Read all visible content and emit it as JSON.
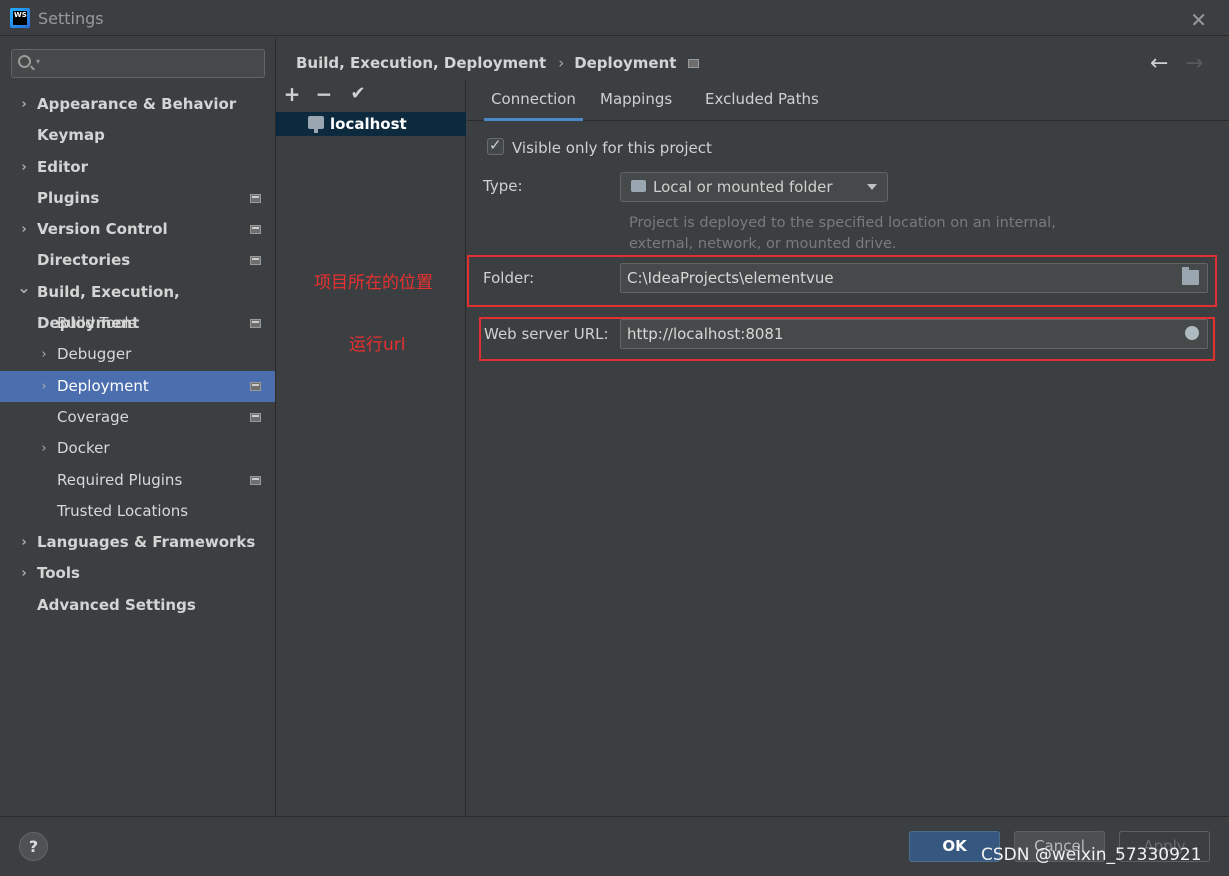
{
  "window": {
    "title": "Settings",
    "logo_text": "WS"
  },
  "sidebar": {
    "search_placeholder": "",
    "items": [
      {
        "label": "Appearance & Behavior",
        "bold": true,
        "chevron": true,
        "indent": 0,
        "project": false
      },
      {
        "label": "Keymap",
        "bold": true,
        "chevron": false,
        "indent": 0,
        "project": false
      },
      {
        "label": "Editor",
        "bold": true,
        "chevron": true,
        "indent": 0,
        "project": false
      },
      {
        "label": "Plugins",
        "bold": true,
        "chevron": false,
        "indent": 0,
        "project": true
      },
      {
        "label": "Version Control",
        "bold": true,
        "chevron": true,
        "indent": 0,
        "project": true
      },
      {
        "label": "Directories",
        "bold": true,
        "chevron": false,
        "indent": 0,
        "project": true
      },
      {
        "label": "Build, Execution, Deployment",
        "bold": true,
        "chevron": "down",
        "indent": 0,
        "project": false
      },
      {
        "label": "Build Tools",
        "bold": false,
        "chevron": false,
        "indent": 1,
        "project": true
      },
      {
        "label": "Debugger",
        "bold": false,
        "chevron": true,
        "indent": 1,
        "project": false
      },
      {
        "label": "Deployment",
        "bold": false,
        "chevron": true,
        "indent": 1,
        "project": true,
        "selected": true
      },
      {
        "label": "Coverage",
        "bold": false,
        "chevron": false,
        "indent": 1,
        "project": true
      },
      {
        "label": "Docker",
        "bold": false,
        "chevron": true,
        "indent": 1,
        "project": false
      },
      {
        "label": "Required Plugins",
        "bold": false,
        "chevron": false,
        "indent": 1,
        "project": true
      },
      {
        "label": "Trusted Locations",
        "bold": false,
        "chevron": false,
        "indent": 1,
        "project": false
      },
      {
        "label": "Languages & Frameworks",
        "bold": true,
        "chevron": true,
        "indent": 0,
        "project": false
      },
      {
        "label": "Tools",
        "bold": true,
        "chevron": true,
        "indent": 0,
        "project": false
      },
      {
        "label": "Advanced Settings",
        "bold": true,
        "chevron": false,
        "indent": 0,
        "project": false
      }
    ]
  },
  "breadcrumb": {
    "parent": "Build, Execution, Deployment",
    "separator": "›",
    "current": "Deployment"
  },
  "servers": {
    "toolbar": {
      "add": "+",
      "remove": "−",
      "default": "✔"
    },
    "items": [
      {
        "label": "localhost"
      }
    ]
  },
  "tabs": [
    {
      "label": "Connection",
      "active": true
    },
    {
      "label": "Mappings"
    },
    {
      "label": "Excluded Paths"
    }
  ],
  "connection": {
    "visible_only_label": "Visible only for this project",
    "visible_only_checked": true,
    "type_label": "Type:",
    "type_value": "Local or mounted folder",
    "type_description": "Project is deployed to the specified location on an internal, external, network, or mounted drive.",
    "folder_label": "Folder:",
    "folder_value": "C:\\IdeaProjects\\elementvue",
    "url_label": "Web server URL:",
    "url_value": "http://localhost:8081"
  },
  "annotations": {
    "folder_note": "项目所在的位置",
    "url_note": "运行url"
  },
  "buttons": {
    "help": "?",
    "ok": "OK",
    "cancel": "Cancel",
    "apply": "Apply"
  },
  "watermark": "CSDN @weixin_57330921",
  "colors": {
    "selection": "#4b6eaf",
    "accent": "#4a88c7",
    "annotation_red": "#e03030"
  }
}
